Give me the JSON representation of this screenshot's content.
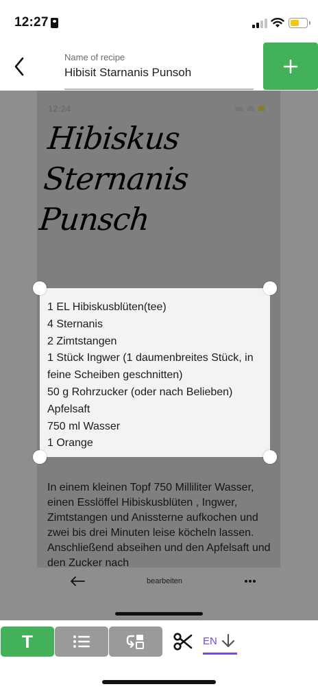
{
  "status_bar": {
    "time": "12:27",
    "battery_color": "#f2c811",
    "signal_icon": "cellular-signal-icon",
    "wifi_icon": "wifi-icon",
    "battery_icon": "battery-icon"
  },
  "header": {
    "back_icon": "chevron-left-icon",
    "field_label": "Name of recipe",
    "field_value": "Hibisit Starnanis Punsoh",
    "add_icon": "plus-icon",
    "accent_color": "#43b05a"
  },
  "preview": {
    "status_time": "12:24",
    "title_lines": [
      "Hibiskus",
      "Sternanis",
      "Punsch"
    ],
    "ingredients": [
      "1 EL Hibiskusblüten(tee)",
      "4 Sternanis",
      "2 Zimtstangen",
      "1 Stück Ingwer (1 daumenbreites Stück, in",
      "feine Scheiben geschnitten)",
      "50 g Rohrzucker (oder nach Belieben)",
      "Apfelsaft",
      "750 ml Wasser",
      "1 Orange"
    ],
    "body_text": "In einem kleinen Topf 750 Milliliter Wasser, einen Esslöffel Hibiskusblüten , Ingwer, Zimtstangen und Anissterne aufkochen und zwei bis drei Minuten leise köcheln lassen. Anschließend abseihen und den Apfelsaft und den Zucker nach",
    "nav_back_icon": "arrow-left-icon",
    "nav_label": "bearbeiten",
    "nav_more_icon": "more-dots-icon"
  },
  "toolbar": {
    "text_mode_label": "T",
    "list_icon": "list-icon",
    "swap_icon": "replace-icon",
    "cut_icon": "scissors-icon",
    "language_label": "EN",
    "language_icon": "download-arrow-icon",
    "language_color": "#7447e6"
  }
}
